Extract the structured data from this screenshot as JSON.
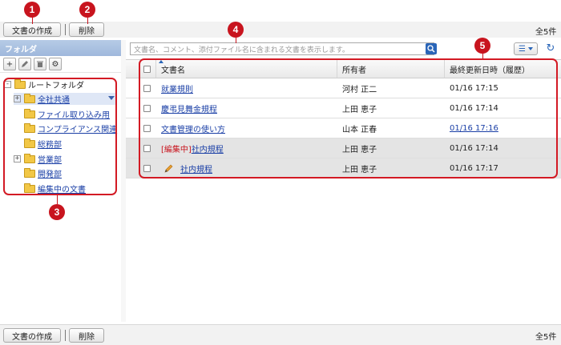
{
  "toolbar": {
    "create_label": "文書の作成",
    "delete_label": "削除",
    "count": "全5件"
  },
  "bottom": {
    "create_label": "文書の作成",
    "delete_label": "削除",
    "count": "全5件"
  },
  "callouts": [
    "1",
    "2",
    "3",
    "4",
    "5"
  ],
  "folders_panel": {
    "title": "フォルダ",
    "tools": [
      "plus-icon",
      "pencil-icon",
      "trash-icon",
      "gear-icon"
    ],
    "tree": [
      {
        "label": "ルートフォルダ",
        "expander": "-"
      },
      {
        "label": "全社共通",
        "expander": "+"
      },
      {
        "label": "ファイル取り込み用"
      },
      {
        "label": "コンプライアンス関連"
      },
      {
        "label": "総務部"
      },
      {
        "label": "営業部",
        "expander": "+"
      },
      {
        "label": "開発部"
      },
      {
        "label": "編集中の文書"
      }
    ]
  },
  "search": {
    "placeholder": "文書名、コメント、添付ファイル名に含まれる文書を表示します。"
  },
  "table": {
    "columns": [
      "文書名",
      "所有者",
      "最終更新日時（履歴）"
    ],
    "rows": [
      {
        "prefix": "",
        "name": "就業規則",
        "owner": "河村 正二",
        "updated": "01/16 17:15"
      },
      {
        "prefix": "",
        "name": "慶弔見舞金規程",
        "owner": "上田 恵子",
        "updated": "01/16 17:14"
      },
      {
        "prefix": "",
        "name": "文書管理の使い方",
        "owner": "山本 正春",
        "updated": "01/16 17:16"
      },
      {
        "prefix": "[編集中]",
        "name": "社内規程",
        "owner": "上田 恵子",
        "updated": "01/16 17:14"
      },
      {
        "prefix": "",
        "name": "社内規程",
        "owner": "上田 恵子",
        "updated": "01/16 17:17"
      }
    ]
  },
  "colors": {
    "callout": "#c8141e",
    "link": "#1a3fa6",
    "editing": "#c8141e",
    "panel_header": "#a9c0e2"
  }
}
